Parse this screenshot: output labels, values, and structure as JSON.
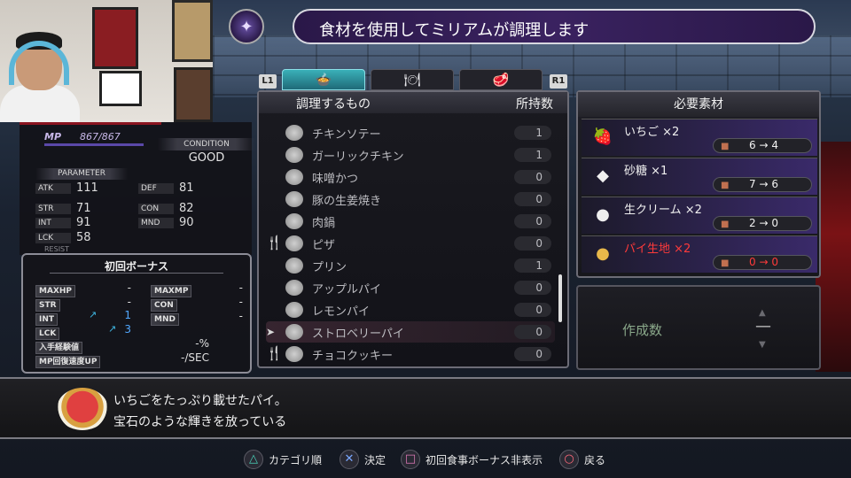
{
  "title": {
    "text": "食材を使用してミリアムが調理します"
  },
  "tabs": {
    "left_button": "L1",
    "right_button": "R1",
    "items": [
      {
        "icon": "chef-hat-icon",
        "glyph": "🍲"
      },
      {
        "icon": "dish-icon",
        "glyph": "🍽"
      },
      {
        "icon": "meat-icon",
        "glyph": "🥩"
      }
    ]
  },
  "recipes": {
    "header_name": "調理するもの",
    "header_qty": "所持数",
    "items": [
      {
        "name": "チキンソテー",
        "qty": "1",
        "mark": ""
      },
      {
        "name": "ガーリックチキン",
        "qty": "1",
        "mark": ""
      },
      {
        "name": "味噌かつ",
        "qty": "0",
        "mark": ""
      },
      {
        "name": "豚の生姜焼き",
        "qty": "0",
        "mark": ""
      },
      {
        "name": "肉鍋",
        "qty": "0",
        "mark": ""
      },
      {
        "name": "ピザ",
        "qty": "0",
        "mark": "🍴"
      },
      {
        "name": "プリン",
        "qty": "1",
        "mark": ""
      },
      {
        "name": "アップルパイ",
        "qty": "0",
        "mark": ""
      },
      {
        "name": "レモンパイ",
        "qty": "0",
        "mark": ""
      },
      {
        "name": "ストロベリーパイ",
        "qty": "0",
        "mark": "➤"
      },
      {
        "name": "チョコクッキー",
        "qty": "0",
        "mark": "🍴"
      }
    ]
  },
  "materials": {
    "header": "必要素材",
    "items": [
      {
        "name": "いちご ×2",
        "count": "6 → 4",
        "glyph": "🍓",
        "insufficient": false
      },
      {
        "name": "砂糖 ×1",
        "count": "7 → 6",
        "glyph": "◆",
        "insufficient": false
      },
      {
        "name": "生クリーム ×2",
        "count": "2 → 0",
        "glyph": "●",
        "insufficient": false
      },
      {
        "name": "パイ生地 ×2",
        "count": "0 → 0",
        "glyph": "●",
        "insufficient": true
      }
    ]
  },
  "create": {
    "label": "作成数",
    "value": "—"
  },
  "description": {
    "line1": "いちごをたっぷり載せたパイ。",
    "line2": "宝石のような輝きを放っている"
  },
  "status": {
    "mp_label": "MP",
    "mp_value": "867/867",
    "condition_label": "CONDITION",
    "condition_value": "GOOD",
    "parameter_label": "PARAMETER",
    "resist_label": "RESIST",
    "stats": [
      {
        "key": "ATK",
        "value": "111"
      },
      {
        "key": "DEF",
        "value": "81"
      },
      {
        "key": "STR",
        "value": "71"
      },
      {
        "key": "CON",
        "value": "82"
      },
      {
        "key": "INT",
        "value": "91"
      },
      {
        "key": "MND",
        "value": "90"
      },
      {
        "key": "LCK",
        "value": "58"
      }
    ]
  },
  "bonus": {
    "title": "初回ボーナス",
    "rows": [
      {
        "key": "MAXHP",
        "value": "-"
      },
      {
        "key": "MAXMP",
        "value": "-"
      },
      {
        "key": "STR",
        "value": "-"
      },
      {
        "key": "CON",
        "value": "-"
      },
      {
        "key": "INT",
        "value": "1"
      },
      {
        "key": "MND",
        "value": "-"
      },
      {
        "key": "LCK",
        "value": "3"
      },
      {
        "key": "入手経験値",
        "value": "-%"
      },
      {
        "key": "MP回復速度UP",
        "value": "-/SEC"
      }
    ]
  },
  "controls": [
    {
      "icon": "triangle-button-icon",
      "glyph": "△",
      "label": "カテゴリ順"
    },
    {
      "icon": "cross-button-icon",
      "glyph": "✕",
      "label": "決定"
    },
    {
      "icon": "square-button-icon",
      "glyph": "□",
      "label": "初回食事ボーナス非表示"
    },
    {
      "icon": "circle-button-icon",
      "glyph": "○",
      "label": "戻る"
    }
  ]
}
